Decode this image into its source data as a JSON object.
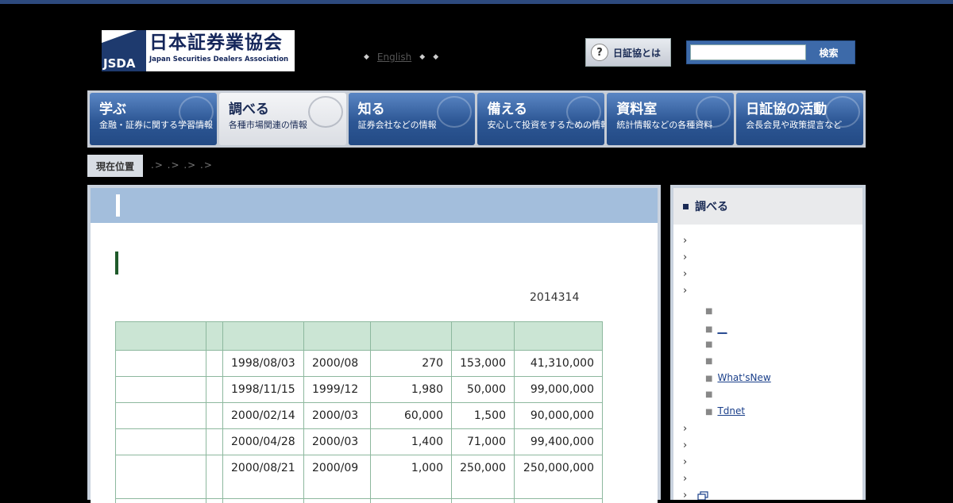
{
  "header": {
    "logo_jp": "日本証券業協会",
    "logo_en": "Japan Securities Dealers Association",
    "logo_mark": "JSDA",
    "lang_link": "English",
    "about_button": "日証協とは",
    "search_button": "検索",
    "search_value": ""
  },
  "nav": [
    {
      "title": "学ぶ",
      "sub": "金融・証券に関する学習情報"
    },
    {
      "title": "調べる",
      "sub": "各種市場関連の情報"
    },
    {
      "title": "知る",
      "sub": "証券会社などの情報"
    },
    {
      "title": "備える",
      "sub": "安心して投資をするための情報"
    },
    {
      "title": "資料室",
      "sub": "統計情報などの各種資料"
    },
    {
      "title": "日証協の活動",
      "sub": "会長会見や政策提言など"
    }
  ],
  "breadcrumb": {
    "label": "現在位置",
    "path": ".> .> .> .>"
  },
  "main": {
    "date": "2014314",
    "rows": [
      [
        "",
        "",
        "1998/08/03",
        "2000/08",
        "270",
        "153,000",
        "41,310,000"
      ],
      [
        "",
        "",
        "1998/11/15",
        "1999/12",
        "1,980",
        "50,000",
        "99,000,000"
      ],
      [
        "",
        "",
        "2000/02/14",
        "2000/03",
        "60,000",
        "1,500",
        "90,000,000"
      ],
      [
        "",
        "",
        "2000/04/28",
        "2000/03",
        "1,400",
        "71,000",
        "99,400,000"
      ],
      [
        "",
        "",
        "2000/08/21",
        "2000/09",
        "1,000",
        "250,000",
        "250,000,000"
      ]
    ]
  },
  "sidebar": {
    "title": "調べる",
    "links": {
      "dash": "__",
      "whatsnew": "What'sNew",
      "tdnet": "Tdnet"
    }
  },
  "colors": {
    "accent": "#2d5795",
    "table_header": "#cbe5d4",
    "panel": "#a3bedc"
  }
}
